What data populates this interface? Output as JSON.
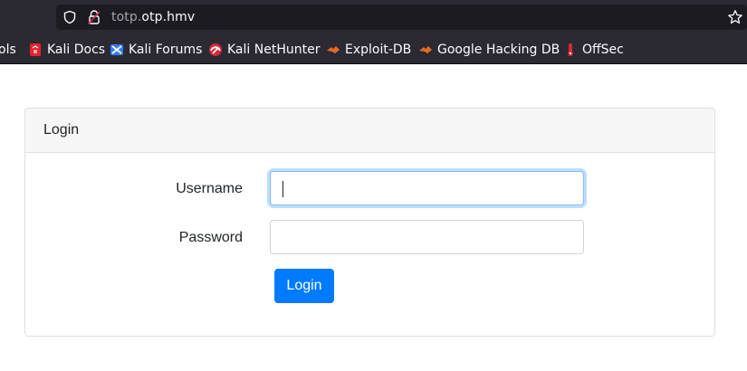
{
  "browser": {
    "url_host_dim": "totp.",
    "url_host": "otp.hmv",
    "bookmarks": [
      {
        "label": "ols",
        "icon": "tools-icon"
      },
      {
        "label": "Kali Docs",
        "icon": "kali-docs-icon"
      },
      {
        "label": "Kali Forums",
        "icon": "kali-forums-icon"
      },
      {
        "label": "Kali NetHunter",
        "icon": "kali-nethunter-icon"
      },
      {
        "label": "Exploit-DB",
        "icon": "exploit-db-icon"
      },
      {
        "label": "Google Hacking DB",
        "icon": "ghdb-icon"
      },
      {
        "label": "OffSec",
        "icon": "offsec-icon"
      }
    ]
  },
  "login": {
    "card_title": "Login",
    "username_label": "Username",
    "username_value": "",
    "password_label": "Password",
    "password_value": "",
    "submit_label": "Login"
  },
  "colors": {
    "accent": "#007bff",
    "chrome": "#2b2a33",
    "urlbar": "#1c1b22"
  }
}
